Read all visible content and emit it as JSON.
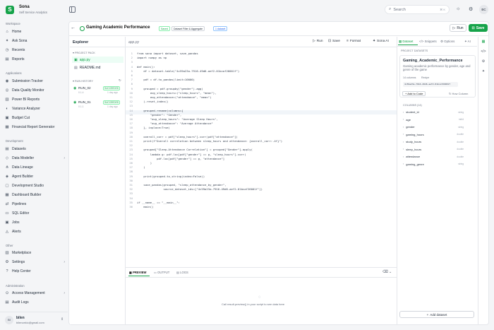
{
  "brand": {
    "name": "Sona",
    "subtitle": "Self Service Analytics",
    "logo_letter": "S"
  },
  "sidebar": {
    "workspace_title": "Workspace",
    "workspace": [
      {
        "label": "Home",
        "icon": "home-icon",
        "glyph": "⌂"
      },
      {
        "label": "Ask Sona",
        "icon": "sparkle-icon",
        "glyph": "✦"
      },
      {
        "label": "Recents",
        "icon": "clock-icon",
        "glyph": "◷"
      },
      {
        "label": "Reports",
        "icon": "report-icon",
        "glyph": "▤"
      }
    ],
    "applications_title": "Applications",
    "applications": [
      {
        "label": "Submission Tracker",
        "icon": "tracker-icon",
        "glyph": "◉"
      },
      {
        "label": "Data Quality Monitor",
        "icon": "monitor-icon",
        "glyph": "◎"
      },
      {
        "label": "Power BI Reports",
        "icon": "chart-icon",
        "glyph": "▥"
      },
      {
        "label": "Variance Analyzer",
        "icon": "variance-icon",
        "glyph": "◐"
      },
      {
        "label": "Budget Cut",
        "icon": "budget-icon",
        "glyph": "▣"
      },
      {
        "label": "Financial Report Generator",
        "icon": "finance-icon",
        "glyph": "▦"
      }
    ],
    "development_title": "Development",
    "development": [
      {
        "label": "Datasets",
        "icon": "dataset-icon",
        "glyph": "▤",
        "chevron": false
      },
      {
        "label": "Data Modeller",
        "icon": "modeller-icon",
        "glyph": "◇",
        "chevron": true
      },
      {
        "label": "Data Lineage",
        "icon": "lineage-icon",
        "glyph": "⋔",
        "chevron": false
      },
      {
        "label": "Agent Builder",
        "icon": "agent-icon",
        "glyph": "◈",
        "chevron": false
      },
      {
        "label": "Development Studio",
        "icon": "studio-icon",
        "glyph": "▢",
        "chevron": false
      },
      {
        "label": "Dashboard Builder",
        "icon": "dashboard-icon",
        "glyph": "▦",
        "chevron": false
      },
      {
        "label": "Pipelines",
        "icon": "pipeline-icon",
        "glyph": "⇄",
        "chevron": false
      },
      {
        "label": "SQL Editor",
        "icon": "sql-icon",
        "glyph": "▭",
        "chevron": false
      },
      {
        "label": "Jobs",
        "icon": "jobs-icon",
        "glyph": "▣",
        "chevron": false
      },
      {
        "label": "Alerts",
        "icon": "alert-icon",
        "glyph": "◬",
        "chevron": false
      }
    ],
    "other_title": "Other",
    "other": [
      {
        "label": "Marketplace",
        "icon": "store-icon",
        "glyph": "▥",
        "chevron": false
      },
      {
        "label": "Settings",
        "icon": "gear-icon",
        "glyph": "⚙",
        "chevron": true
      },
      {
        "label": "Help Center",
        "icon": "help-icon",
        "glyph": "?",
        "chevron": false
      }
    ],
    "admin_title": "Administration",
    "admin": [
      {
        "label": "Access Management",
        "icon": "lock-icon",
        "glyph": "⊙",
        "chevron": true
      },
      {
        "label": "Audit Logs",
        "icon": "log-icon",
        "glyph": "▤",
        "chevron": false
      }
    ],
    "user": {
      "initials": "BI",
      "name": "bilen",
      "email": "bilencekic@gmail.com"
    }
  },
  "topbar": {
    "search_placeholder": "Search",
    "shortcut": "⌘ K",
    "avatar": "BC"
  },
  "header": {
    "title": "Gaming Academic Performance",
    "badges": [
      "Saved",
      "Dataset Filter & Aggregate",
      "1 dataset"
    ],
    "run_label": "Run",
    "save_label": "Save"
  },
  "explorer": {
    "title": "Explorer",
    "project_pack_label": "PROJECT PACK",
    "files": [
      "app.py",
      "README.md"
    ],
    "run_history_label": "RUN HISTORY",
    "runs": [
      {
        "name": "RUN_02",
        "status": "SUCCEEDED",
        "meta": "0.1.4",
        "ago": "1 day ago"
      },
      {
        "name": "RUN_01",
        "status": "SUCCEEDED",
        "meta": "0.1.1",
        "ago": "1 day ago"
      }
    ]
  },
  "editor": {
    "filename": "app.py",
    "toolbar": [
      "Run",
      "Save",
      "Format",
      "Sona AI"
    ],
    "lines": [
      "from sona import dataset, save_pandas",
      "import numpy as np",
      "",
      "def main():",
      "    df = dataset.table(\"4c59a23a-7916-49d6-aef2-01bcaf26001f\")",
      "",
      "    pdf = df.to_pandas(limit=10000)",
      "",
      "    grouped = pdf.groupby(\"gender\").agg(",
      "        avg_sleep_hours=(\"sleep_hours\", \"mean\"),",
      "        avg_attendance=(\"attendance\", \"mean\")",
      "    ).reset_index()",
      "",
      "    grouped.rename(columns={",
      "        \"gender\": \"Gender\",",
      "        \"avg_sleep_hours\": \"Average Sleep Hours\",",
      "        \"avg_attendance\": \"Average Attendance\"",
      "    }, inplace=True)",
      "",
      "    overall_corr = pdf[\"sleep_hours\"].corr(pdf[\"attendance\"])",
      "    print(f\"Overall correlation between sleep_hours and attendance: {overall_corr:.4f}\")",
      "",
      "    grouped[\"Sleep-Attendance Correlation\"] = grouped[\"Gender\"].apply(",
      "        lambda g: pdf.loc[pdf[\"gender\"] == g, \"sleep_hours\"].corr(",
      "            pdf.loc[pdf[\"gender\"] == g, \"attendance\"]",
      "        )",
      "    )",
      "",
      "    print(grouped.to_string(index=False))",
      "",
      "    save_pandas(grouped, \"sleep_attendance_by_gender\",",
      "                source_dataset_ids=[\"4c59a23a-7916-49d6-aef2-01bcaf26001f\"])",
      "",
      "",
      "if __name__ == \"__main__\":",
      "    main()"
    ],
    "line_numbers": [
      "1",
      "2",
      "3",
      "4",
      "5",
      "6",
      "7",
      "8",
      "9",
      "10",
      "11",
      "12",
      "13",
      "14",
      "15",
      "16",
      "17",
      "18",
      "19",
      "20",
      "21",
      "22",
      "23",
      "24",
      "25",
      "26",
      "27",
      "28",
      "29",
      "30",
      "31",
      "32",
      "33",
      "34",
      "35",
      "36"
    ]
  },
  "bottom": {
    "tabs": [
      "PREVIEW",
      "OUTPUT",
      "LOGS"
    ],
    "empty_text": "Call result.preview() in your script to see data here"
  },
  "right": {
    "tabs": [
      "Dataset",
      "Snippets",
      "Options",
      "AI"
    ],
    "section": "PROJECT DATASETS",
    "dataset_name": "Gaming_Academic_Performance",
    "dataset_desc": "Gaming academic performance by gender, age and genre of the game",
    "meta_cols": "14 columns",
    "meta_recipe": "Recipe",
    "dataset_id": "4c59a23a-7916-49d6-aef2-01bcaf26001f",
    "add_code": "Add to Code",
    "how_column": "How Column",
    "columns_label": "COLUMNS (14)",
    "columns": [
      {
        "name": "student_id",
        "type": "string"
      },
      {
        "name": "age",
        "type": "int64"
      },
      {
        "name": "gender",
        "type": "string"
      },
      {
        "name": "gaming_hours",
        "type": "double"
      },
      {
        "name": "study_hours",
        "type": "double"
      },
      {
        "name": "sleep_hours",
        "type": "double"
      },
      {
        "name": "attendance",
        "type": "double"
      },
      {
        "name": "gaming_genre",
        "type": "string"
      }
    ],
    "add_dataset": "Add dataset"
  }
}
